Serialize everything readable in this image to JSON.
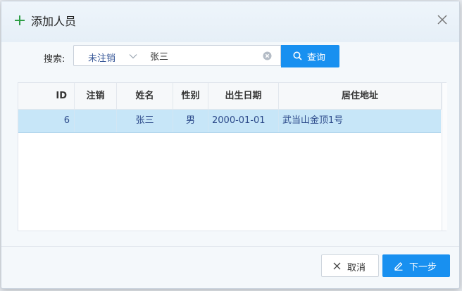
{
  "dialog": {
    "title": "添加人员",
    "icons": {
      "title": "plus-icon",
      "close": "close-icon"
    },
    "accent_color": "#1890f0",
    "title_icon_color": "#2e9e45"
  },
  "search": {
    "label": "搜索:",
    "status_select": {
      "selected": "未注销"
    },
    "query_value": "张三",
    "button_label": "查询",
    "icons": {
      "clear": "clear-icon",
      "search": "search-icon",
      "chevron": "chevron-down-icon"
    }
  },
  "table": {
    "columns": [
      "ID",
      "注销",
      "姓名",
      "性别",
      "出生日期",
      "居住地址"
    ],
    "rows": [
      {
        "id": "6",
        "cancelled": "",
        "name": "张三",
        "gender": "男",
        "birth_date": "2000-01-01",
        "address": "武当山金顶1号"
      }
    ],
    "selected_row_color": "#c7e6f8"
  },
  "footer": {
    "cancel_label": "取消",
    "next_label": "下一步",
    "icons": {
      "cancel": "x-icon",
      "next": "pencil-icon"
    }
  }
}
